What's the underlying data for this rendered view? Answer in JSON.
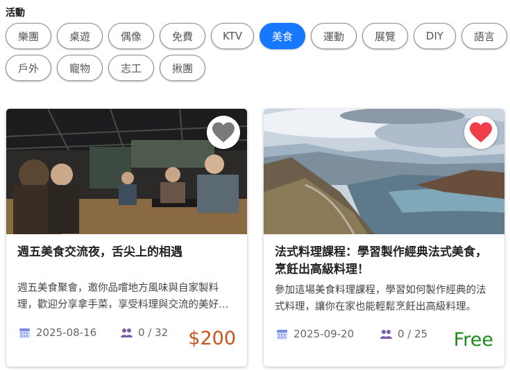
{
  "section": {
    "title": "活動"
  },
  "categories": {
    "row1": [
      "樂團",
      "桌遊",
      "偶像",
      "免費",
      "KTV",
      "美食",
      "運動",
      "展覽",
      "DIY",
      "語言"
    ],
    "row2": [
      "戶外",
      "寵物",
      "志工",
      "揪團"
    ],
    "active": "美食"
  },
  "colors": {
    "accent": "#1677ff",
    "price_paid": "#c8541c",
    "price_free": "#1e8a1e",
    "fav_on": "#f03e4a",
    "fav_off": "#7a7a7a"
  },
  "events": [
    {
      "title": "週五美食交流夜，舌尖上的相遇",
      "description": "週五美食聚會，邀你品嚐地方風味與自家製料理，歡迎分享拿手菜，享受料理與交流的美好時光。",
      "date": "2025-08-16",
      "attendees": "0 / 32",
      "price": "$200",
      "favorited": false,
      "image_icon": "food-hall-photo"
    },
    {
      "title": "法式料理課程：學習製作經典法式美食，烹飪出高級料理！",
      "description": "參加這場美食料理課程，學習如何製作經典的法式料理，讓你在家也能輕鬆烹飪出高級料理。",
      "date": "2025-09-20",
      "attendees": "0 / 25",
      "price": "Free",
      "favorited": true,
      "image_icon": "mountain-lake-photo"
    }
  ]
}
